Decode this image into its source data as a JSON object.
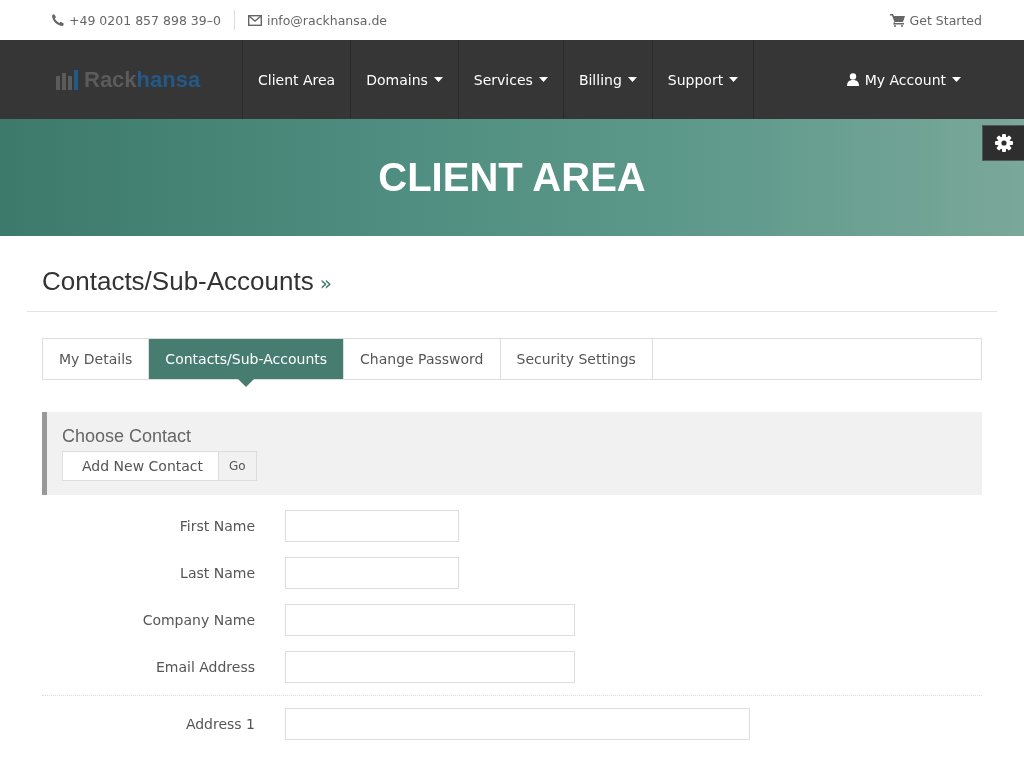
{
  "topbar": {
    "phone": "+49 0201 857 898 39–0",
    "email": "info@rackhansa.de",
    "cart_link": "Get Started"
  },
  "navbar": {
    "logo": {
      "first": "Rack",
      "second": "hansa"
    },
    "items": [
      {
        "label": "Client Area",
        "dropdown": false
      },
      {
        "label": "Domains",
        "dropdown": true
      },
      {
        "label": "Services",
        "dropdown": true
      },
      {
        "label": "Billing",
        "dropdown": true
      },
      {
        "label": "Support",
        "dropdown": true
      }
    ],
    "account": {
      "label": "My Account",
      "dropdown": true
    }
  },
  "hero": {
    "title": "CLIENT AREA"
  },
  "page_title": "Contacts/Sub-Accounts",
  "breadcrumb_mark": "»",
  "tabs": [
    {
      "label": "My Details",
      "selected": false
    },
    {
      "label": "Contacts/Sub-Accounts",
      "selected": true
    },
    {
      "label": "Change Password",
      "selected": false
    },
    {
      "label": "Security Settings",
      "selected": false
    }
  ],
  "choose_contact": {
    "title": "Choose Contact",
    "select_value": "Add New Contact",
    "button": "Go"
  },
  "form": [
    {
      "label": "First Name",
      "kind": "short",
      "divider_before": false
    },
    {
      "label": "Last Name",
      "kind": "short",
      "divider_before": false
    },
    {
      "label": "Company Name",
      "kind": "medium",
      "divider_before": false
    },
    {
      "label": "Email Address",
      "kind": "medium",
      "divider_before": false
    },
    {
      "label": "Address 1",
      "kind": "long",
      "divider_before": true
    }
  ]
}
